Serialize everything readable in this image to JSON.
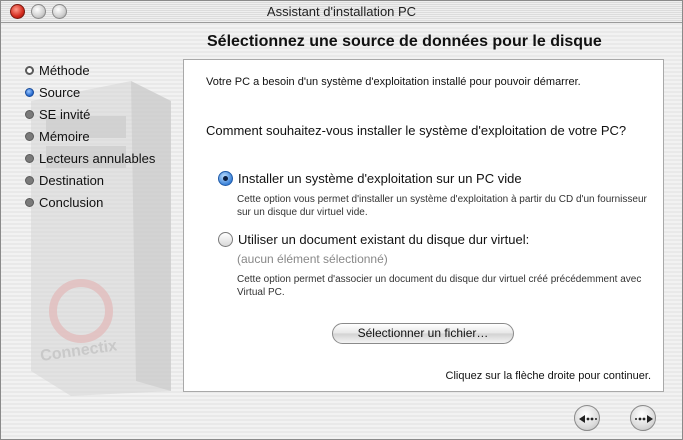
{
  "window": {
    "title": "Assistant d'installation PC"
  },
  "page": {
    "heading": "Sélectionnez une source de données pour le disque"
  },
  "sidebar": {
    "steps": [
      {
        "label": "Méthode",
        "state": "done"
      },
      {
        "label": "Source",
        "state": "current"
      },
      {
        "label": "SE invité",
        "state": "todo"
      },
      {
        "label": "Mémoire",
        "state": "todo"
      },
      {
        "label": "Lecteurs annulables",
        "state": "todo"
      },
      {
        "label": "Destination",
        "state": "todo"
      },
      {
        "label": "Conclusion",
        "state": "todo"
      }
    ],
    "decoration": {
      "icon": "pc-tower-icon",
      "brand": "Connectix"
    }
  },
  "panel": {
    "intro": "Votre PC a besoin d'un système d'exploitation installé pour pouvoir démarrer.",
    "question": "Comment souhaitez-vous installer le système d'exploitation de votre PC?",
    "options": [
      {
        "label": "Installer un système d'exploitation sur un PC vide",
        "selected": true,
        "description": "Cette option vous permet d'installer un système d'exploitation à partir du CD d'un fournisseur sur un disque dur virtuel vide."
      },
      {
        "label": "Utiliser un document existant du disque dur virtuel:",
        "selected": false,
        "current_value": "(aucun élément sélectionné)",
        "description": "Cette option permet d'associer un document du disque dur virtuel créé précédemment avec Virtual PC."
      }
    ],
    "select_file_label": "Sélectionner un fichier…",
    "continue_hint": "Cliquez sur la flèche droite pour continuer."
  },
  "navigation": {
    "back_icon": "back-arrow-icon",
    "forward_icon": "forward-arrow-icon"
  },
  "colors": {
    "accent": "#2266cc",
    "close": "#d42b1e"
  }
}
